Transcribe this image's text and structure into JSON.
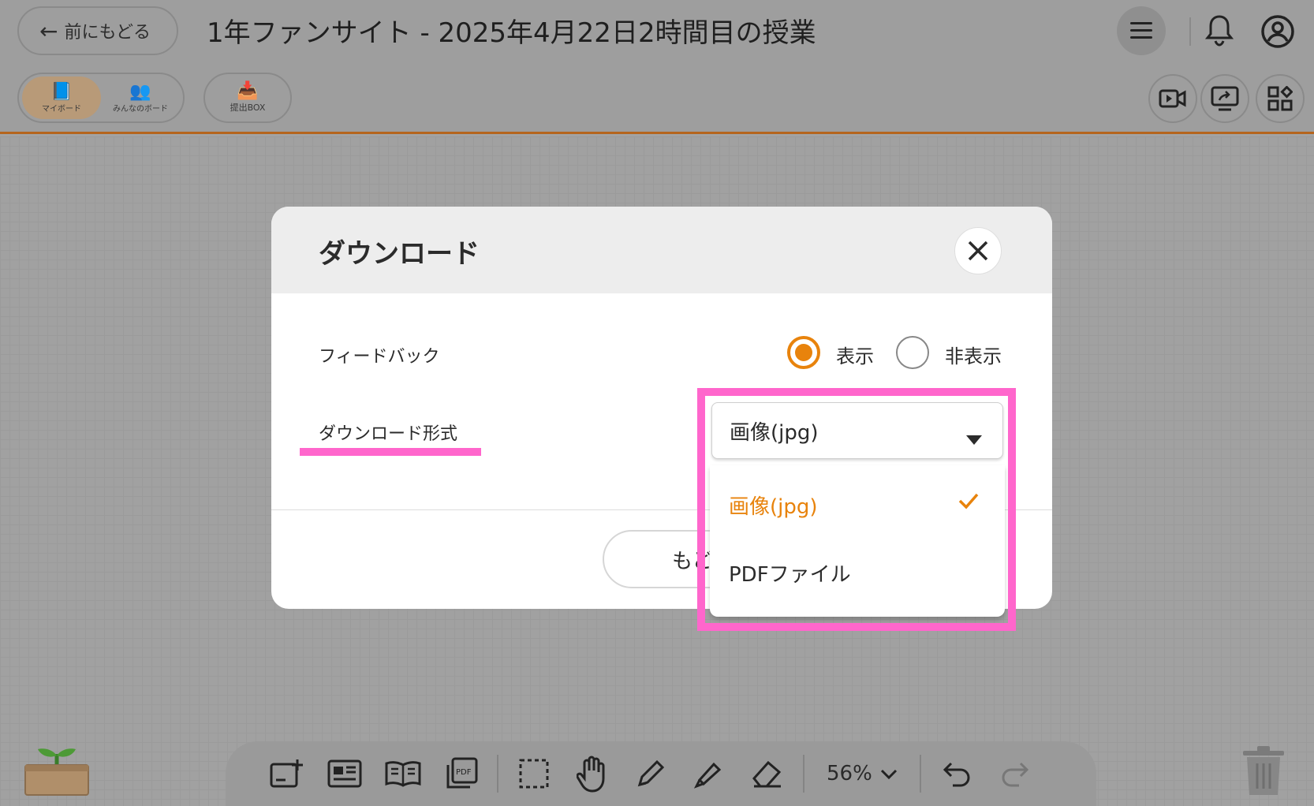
{
  "header": {
    "back_label": "前にもどる",
    "title": "1年ファンサイト - 2025年4月22日2時間目の授業",
    "menu_icon": "hamburger-menu-icon",
    "bell_icon": "bell-icon",
    "user_icon": "user-circle-icon"
  },
  "board_switch": {
    "my_board": "マイボード",
    "everyone_board": "みんなのボード"
  },
  "submit_box": "提出BOX",
  "right_tools": [
    "video-icon",
    "screen-share-icon",
    "apps-icon"
  ],
  "dialog": {
    "title": "ダウンロード",
    "feedback_label": "フィードバック",
    "radio_show": "表示",
    "radio_hide": "非表示",
    "radio_selected": "表示",
    "format_label": "ダウンロード形式",
    "format_value": "画像(jpg)",
    "back_button": "もどる"
  },
  "dropdown": {
    "options": [
      "画像(jpg)",
      "PDFファイル"
    ],
    "selected": "画像(jpg)"
  },
  "toolbar": {
    "zoom": "56%"
  },
  "colors": {
    "accent": "#e8830c",
    "highlight": "#ff66cc"
  }
}
